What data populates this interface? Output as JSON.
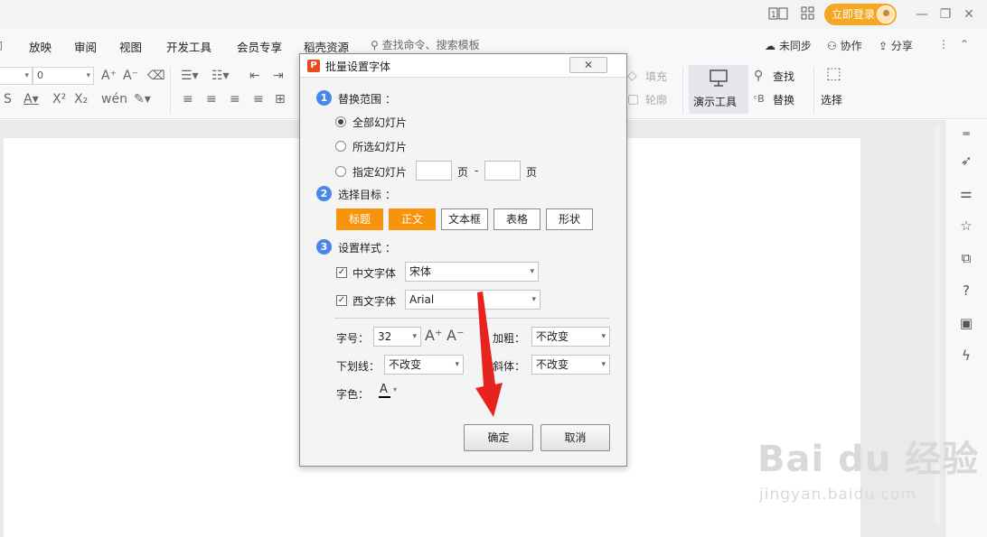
{
  "titlebar": {
    "login_label": "立即登录"
  },
  "menubar": {
    "tabs": [
      "放映",
      "审阅",
      "视图",
      "开发工具",
      "会员专享",
      "稻壳资源"
    ],
    "search_placeholder": "查找命令、搜索模板",
    "sync_label": "未同步",
    "collab_label": "协作",
    "share_label": "分享"
  },
  "ribbon": {
    "font_size_value": "0",
    "fill_label": "填充",
    "outline_label": "轮廓",
    "demo_tools_label": "演示工具",
    "find_label": "查找",
    "replace_label": "替换",
    "select_label": "选择"
  },
  "dialog": {
    "title": "批量设置字体",
    "close_glyph": "✕",
    "section1": {
      "number": "1",
      "title": "替换范围 ：",
      "options": [
        "全部幻灯片",
        "所选幻灯片",
        "指定幻灯片"
      ],
      "selected_option": "全部幻灯片",
      "page_label": "页",
      "dash": "-"
    },
    "section2": {
      "number": "2",
      "title": "选择目标 ：",
      "targets": [
        "标题",
        "正文",
        "文本框",
        "表格",
        "形状"
      ],
      "selected_targets": [
        "标题",
        "正文"
      ]
    },
    "section3": {
      "number": "3",
      "title": "设置样式 ：",
      "cn_font_label": "中文字体",
      "cn_font_value": "宋体",
      "en_font_label": "西文字体",
      "en_font_value": "Arial",
      "size_label": "字号：",
      "size_value": "32",
      "bold_label": "加粗：",
      "bold_value": "不改变",
      "underline_label": "下划线：",
      "underline_value": "不改变",
      "italic_label": "斜体：",
      "italic_value": "不改变",
      "color_label": "字色：",
      "color_glyph": "A"
    },
    "ok_label": "确定",
    "cancel_label": "取消"
  },
  "watermark": {
    "brand": "Bai du 经验",
    "url": "jingyan.baidu.com"
  },
  "colors": {
    "accent_orange": "#f7940c",
    "login_orange": "#f5a623",
    "section_blue": "#4a86e8",
    "arrow_red": "#e8231f"
  }
}
